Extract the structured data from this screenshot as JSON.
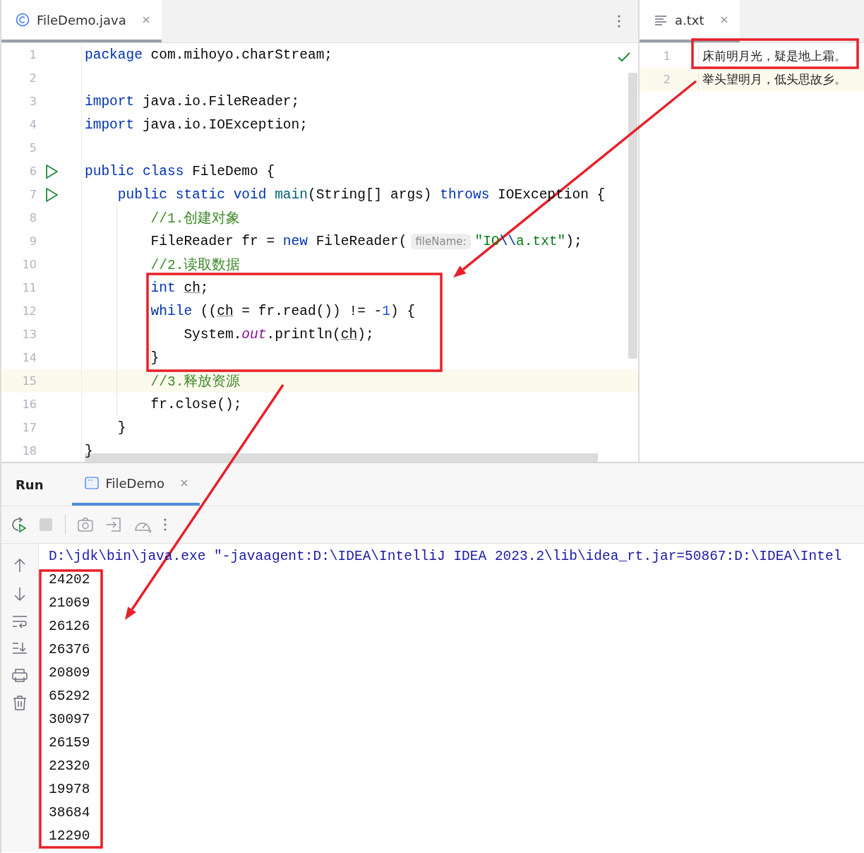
{
  "left_editor": {
    "tab": {
      "label": "FileDemo.java",
      "selected": true
    },
    "no_problems": true,
    "lines": [
      {
        "number": "1",
        "run": false,
        "current": false,
        "tokens": [
          {
            "kind": "kw",
            "text": "package"
          },
          {
            "kind": "p",
            "text": " com.mihoyo.charStream;"
          }
        ]
      },
      {
        "number": "2",
        "run": false,
        "current": false
      },
      {
        "number": "3",
        "run": false,
        "current": false,
        "tokens": [
          {
            "kind": "kw",
            "text": "import"
          },
          {
            "kind": "p",
            "text": " java.io.FileReader;"
          }
        ]
      },
      {
        "number": "4",
        "run": false,
        "current": false,
        "tokens": [
          {
            "kind": "kw",
            "text": "import"
          },
          {
            "kind": "p",
            "text": " java.io.IOException;"
          }
        ]
      },
      {
        "number": "5",
        "run": false,
        "current": false
      },
      {
        "number": "6",
        "run": true,
        "current": false,
        "tokens": [
          {
            "kind": "kw",
            "text": "public class"
          },
          {
            "kind": "p",
            "text": " FileDemo {"
          }
        ]
      },
      {
        "number": "7",
        "run": true,
        "current": false,
        "tokens": [
          {
            "kind": "kw",
            "text": "    public static void "
          },
          {
            "kind": "fn",
            "text": "main"
          },
          {
            "kind": "p",
            "text": "(String[] args) "
          },
          {
            "kind": "kw",
            "text": "throws"
          },
          {
            "kind": "p",
            "text": " IOException {"
          }
        ]
      },
      {
        "number": "8",
        "run": false,
        "current": false,
        "tokens": [
          {
            "kind": "cm",
            "text": "        //1.创建对象"
          }
        ]
      },
      {
        "number": "9",
        "run": false,
        "current": false,
        "tokens": [
          {
            "kind": "p",
            "text": "        FileReader fr = "
          },
          {
            "kind": "kw",
            "text": "new"
          },
          {
            "kind": "p",
            "text": " FileReader("
          },
          {
            "kind": "hint",
            "text": "fileName:"
          },
          {
            "kind": "str",
            "text": "\"IO"
          },
          {
            "kind": "esc",
            "text": "\\\\"
          },
          {
            "kind": "str",
            "text": "a.txt\""
          },
          {
            "kind": "p",
            "text": ");"
          }
        ]
      },
      {
        "number": "10",
        "run": false,
        "current": false,
        "tokens": [
          {
            "kind": "cm",
            "text": "        //2.读取数据"
          }
        ]
      },
      {
        "number": "11",
        "run": false,
        "current": false,
        "tokens": [
          {
            "kind": "kw",
            "text": "        int "
          },
          {
            "kind": "var",
            "text": "ch"
          },
          {
            "kind": "p",
            "text": ";"
          }
        ]
      },
      {
        "number": "12",
        "run": false,
        "current": false,
        "tokens": [
          {
            "kind": "kw",
            "text": "        while"
          },
          {
            "kind": "p",
            "text": " (("
          },
          {
            "kind": "var",
            "text": "ch"
          },
          {
            "kind": "p",
            "text": " = fr.read()) != -"
          },
          {
            "kind": "num",
            "text": "1"
          },
          {
            "kind": "p",
            "text": ") {"
          }
        ]
      },
      {
        "number": "13",
        "run": false,
        "current": false,
        "tokens": [
          {
            "kind": "p",
            "text": "            System."
          },
          {
            "kind": "field",
            "text": "out"
          },
          {
            "kind": "p",
            "text": ".println("
          },
          {
            "kind": "var",
            "text": "ch"
          },
          {
            "kind": "p",
            "text": ");"
          }
        ]
      },
      {
        "number": "14",
        "run": false,
        "current": false,
        "tokens": [
          {
            "kind": "p",
            "text": "        }"
          }
        ]
      },
      {
        "number": "15",
        "run": false,
        "current": true,
        "tokens": [
          {
            "kind": "cm",
            "text": "        //3.释放资源"
          }
        ]
      },
      {
        "number": "16",
        "run": false,
        "current": false,
        "tokens": [
          {
            "kind": "p",
            "text": "        fr.close();"
          }
        ]
      },
      {
        "number": "17",
        "run": false,
        "current": false,
        "tokens": [
          {
            "kind": "p",
            "text": "    }"
          }
        ]
      },
      {
        "number": "18",
        "run": false,
        "current": false,
        "tokens": [
          {
            "kind": "p",
            "text": "}"
          }
        ]
      }
    ]
  },
  "right_editor": {
    "tab": {
      "label": "a.txt",
      "selected": true
    },
    "lines": [
      {
        "number": "1",
        "current": false,
        "text": "床前明月光，疑是地上霜。"
      },
      {
        "number": "2",
        "current": true,
        "text": "举头望明月，低头思故乡。"
      }
    ]
  },
  "run_panel": {
    "title": "Run",
    "tabs": [
      {
        "label": "FileDemo",
        "selected": true
      }
    ],
    "console": [
      {
        "kind": "command",
        "text": "D:\\jdk\\bin\\java.exe \"-javaagent:D:\\IDEA\\IntelliJ IDEA 2023.2\\lib\\idea_rt.jar=50867:D:\\IDEA\\Intel"
      },
      {
        "kind": "output",
        "text": "24202"
      },
      {
        "kind": "output",
        "text": "21069"
      },
      {
        "kind": "output",
        "text": "26126"
      },
      {
        "kind": "output",
        "text": "26376"
      },
      {
        "kind": "output",
        "text": "20809"
      },
      {
        "kind": "output",
        "text": "65292"
      },
      {
        "kind": "output",
        "text": "30097"
      },
      {
        "kind": "output",
        "text": "26159"
      },
      {
        "kind": "output",
        "text": "22320"
      },
      {
        "kind": "output",
        "text": "19978"
      },
      {
        "kind": "output",
        "text": "38684"
      },
      {
        "kind": "output",
        "text": "12290"
      }
    ]
  },
  "annotations": [
    {
      "kind": "box"
    },
    {
      "kind": "box"
    },
    {
      "kind": "box"
    },
    {
      "kind": "arrow"
    },
    {
      "kind": "arrow"
    }
  ]
}
